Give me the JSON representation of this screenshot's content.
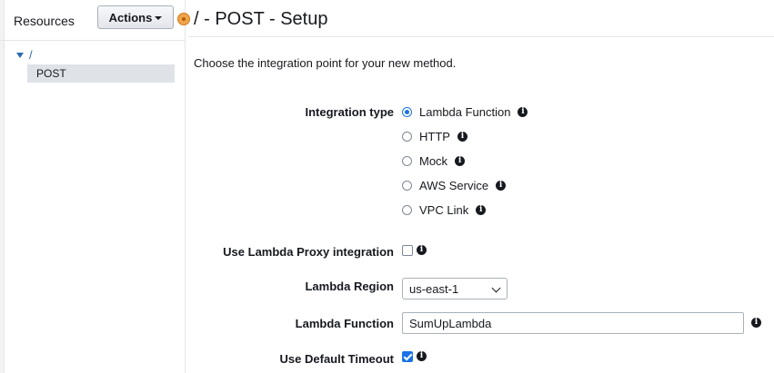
{
  "sidebar": {
    "title": "Resources",
    "actions_label": "Actions",
    "tree": {
      "root_label": "/",
      "child_label": "POST"
    }
  },
  "page": {
    "title": "/ - POST - Setup",
    "intro": "Choose the integration point for your new method."
  },
  "form": {
    "integration_type": {
      "label": "Integration type",
      "options": [
        {
          "label": "Lambda Function",
          "selected": true
        },
        {
          "label": "HTTP",
          "selected": false
        },
        {
          "label": "Mock",
          "selected": false
        },
        {
          "label": "AWS Service",
          "selected": false
        },
        {
          "label": "VPC Link",
          "selected": false
        }
      ]
    },
    "proxy": {
      "label": "Use Lambda Proxy integration",
      "checked": false
    },
    "region": {
      "label": "Lambda Region",
      "value": "us-east-1"
    },
    "function": {
      "label": "Lambda Function",
      "value": "SumUpLambda"
    },
    "timeout": {
      "label": "Use Default Timeout",
      "checked": true
    }
  },
  "colors": {
    "accent": "#1a73e8",
    "indicator": "#f0a44b"
  }
}
